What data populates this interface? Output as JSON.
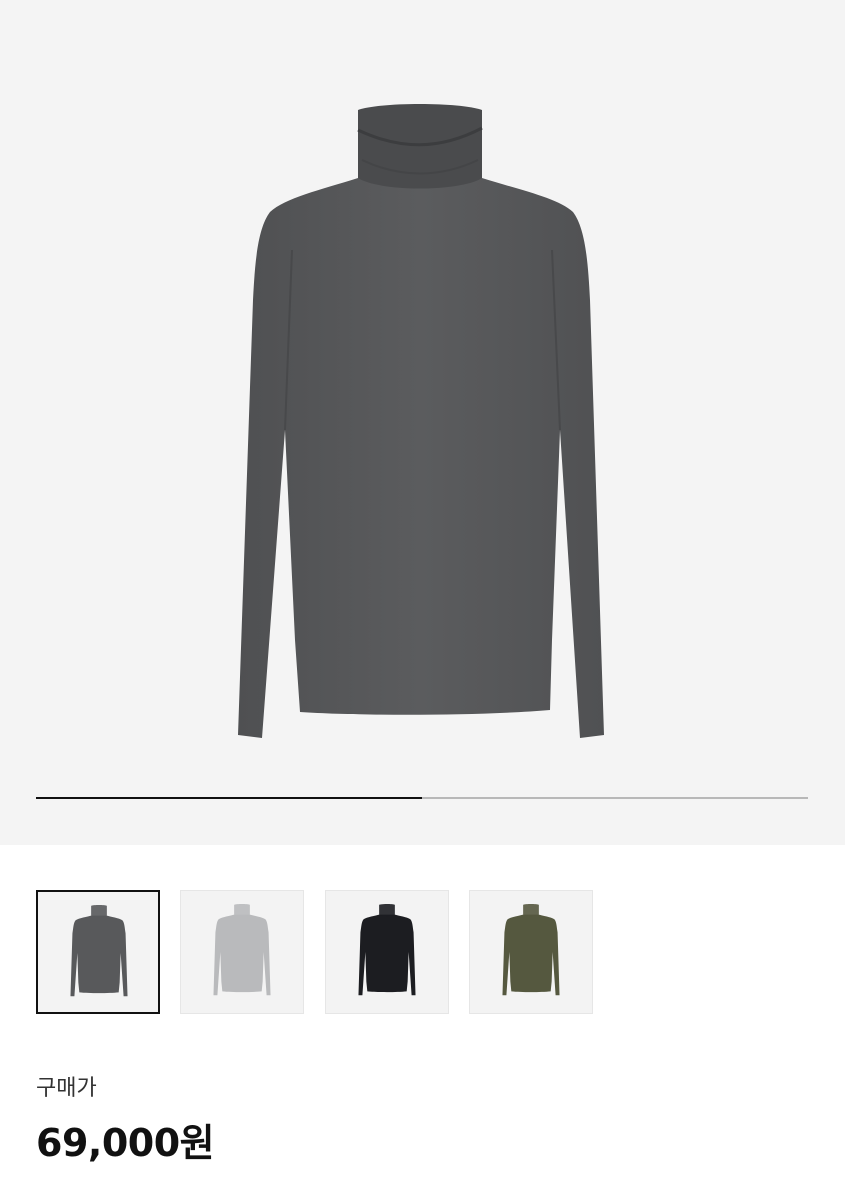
{
  "product": {
    "colors": {
      "charcoal": "#58595b",
      "light_gray": "#b9babc",
      "black": "#1c1d21",
      "olive": "#55583f"
    },
    "selected_thumbnail": 0
  },
  "gallery": {
    "progress_fraction": 0.5
  },
  "thumbnails": [
    {
      "color": "#58595b",
      "name": "charcoal"
    },
    {
      "color": "#b9babc",
      "name": "light-gray"
    },
    {
      "color": "#1c1d21",
      "name": "black"
    },
    {
      "color": "#55583f",
      "name": "olive"
    }
  ],
  "price": {
    "label": "구매가",
    "value": "69,000원"
  }
}
